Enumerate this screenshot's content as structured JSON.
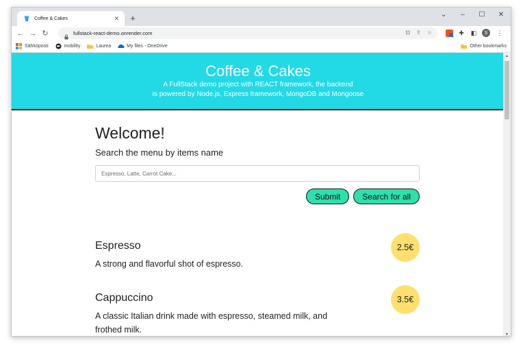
{
  "browser": {
    "tab_title": "Coffee & Cakes",
    "url": "fullstack-react-demo.onrender.com",
    "profile_initial": "S",
    "bookmarks": [
      "Sähköposti",
      "mobility",
      "Laurea",
      "My files - OneDrive"
    ],
    "other_bookmarks": "Other bookmarks"
  },
  "hero": {
    "title": "Coffee & Cakes",
    "line1": "A FullStack demo project with REACT framework, the backend",
    "line2": "is powered by Node.js, Express framework, MongoDB and Mongoose"
  },
  "main": {
    "welcome": "Welcome!",
    "subtitle": "Search the menu by items name",
    "search_placeholder": "Espresso, Latte, Carrot Cake...",
    "submit_label": "Submit",
    "search_all_label": "Search for all"
  },
  "items": [
    {
      "name": "Espresso",
      "description": "A strong and flavorful shot of espresso.",
      "price": "2.5€"
    },
    {
      "name": "Cappuccino",
      "description": "A classic Italian drink made with espresso, steamed milk, and frothed milk.",
      "price": "3.5€"
    }
  ],
  "colors": {
    "hero": "#22d9e6",
    "buttons": "#2fe0ac",
    "price_badge": "#ffe06e"
  }
}
